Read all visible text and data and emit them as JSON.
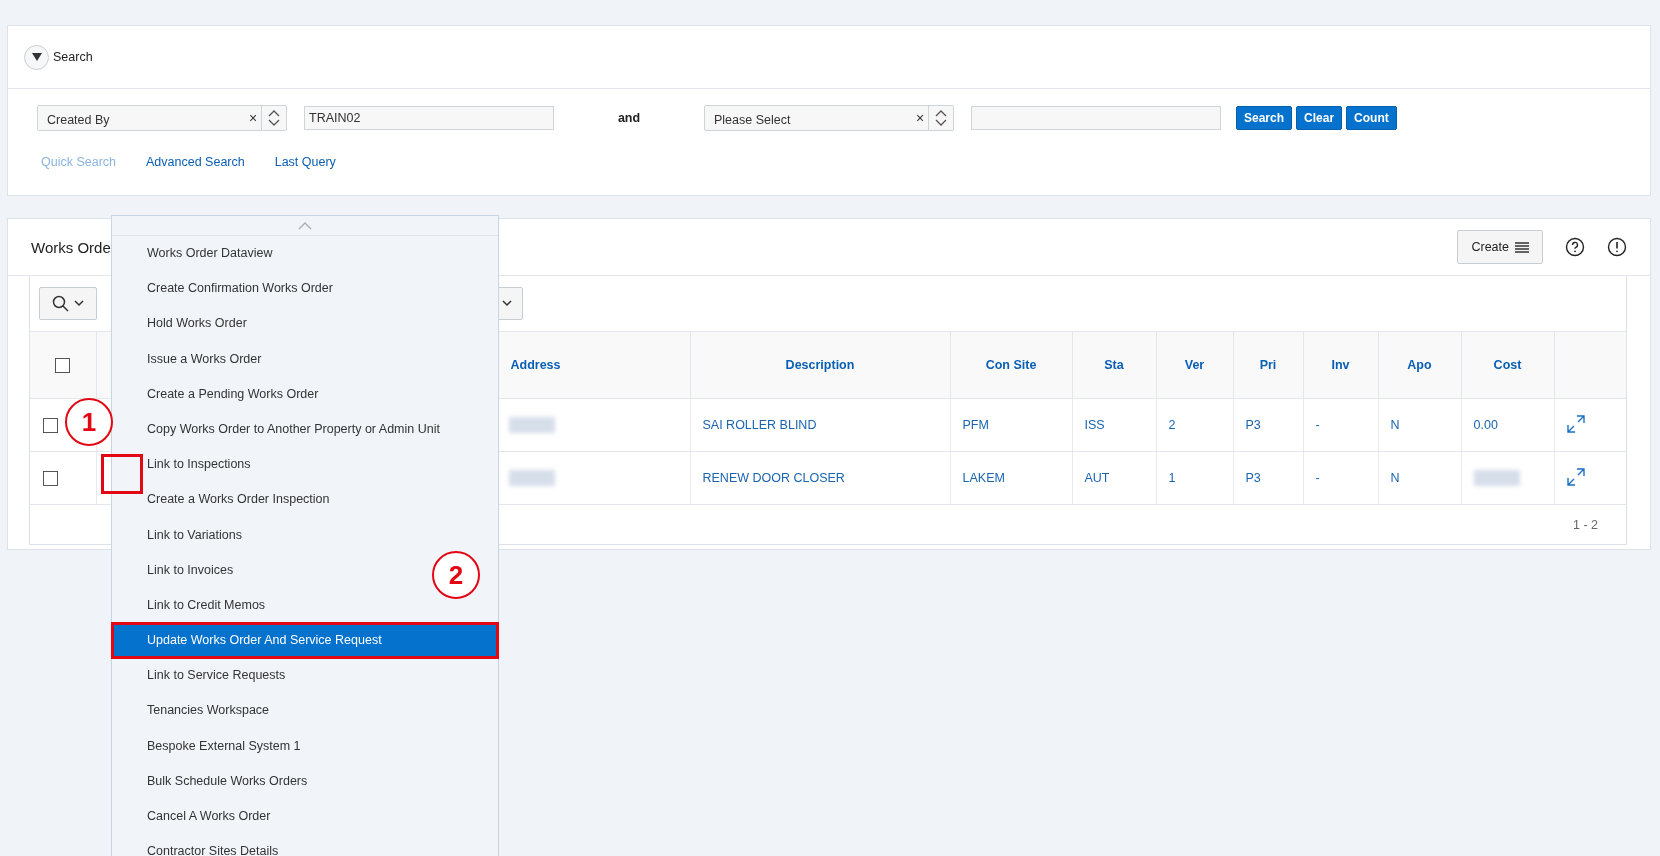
{
  "search": {
    "title": "Search",
    "criteria": [
      {
        "field": "Created By",
        "clear_icon": "×",
        "value": "TRAIN02"
      },
      {
        "field": "Please Select",
        "clear_icon": "×"
      }
    ],
    "conjunction": "and",
    "buttons": [
      "Search",
      "Clear",
      "Count"
    ],
    "links": [
      {
        "label": "Quick Search",
        "selected": true
      },
      {
        "label": "Advanced Search",
        "selected": false
      },
      {
        "label": "Last Query",
        "selected": false
      }
    ]
  },
  "works_orders": {
    "title": "Works Orde",
    "create_button": "Create",
    "table": {
      "all_checked": false,
      "columns": [
        "Address",
        "Description",
        "Con Site",
        "Sta",
        "Ver",
        "Pri",
        "Inv",
        "Apo",
        "Cost"
      ],
      "rows": [
        {
          "checked": false,
          "description": "SAI ROLLER BLIND",
          "con_site": "PFM",
          "sta": "ISS",
          "ver": "2",
          "pri": "P3",
          "inv": "-",
          "apo": "N",
          "cost": "0.00"
        },
        {
          "checked": false,
          "description": "RENEW DOOR CLOSER",
          "con_site": "LAKEM",
          "sta": "AUT",
          "ver": "1",
          "pri": "P3",
          "inv": "-",
          "apo": "N"
        }
      ],
      "pagination": "1 - 2"
    }
  },
  "row_menu": {
    "items": [
      {
        "label": "Works Order Dataview",
        "selected": false
      },
      {
        "label": "Create Confirmation Works Order",
        "selected": false
      },
      {
        "label": "Hold Works Order",
        "selected": false
      },
      {
        "label": "Issue a Works Order",
        "selected": false
      },
      {
        "label": "Create a Pending Works Order",
        "selected": false
      },
      {
        "label": "Copy Works Order to Another Property or Admin Unit",
        "selected": false
      },
      {
        "label": "Link to Inspections",
        "selected": false
      },
      {
        "label": "Create a Works Order Inspection",
        "selected": false
      },
      {
        "label": "Link to Variations",
        "selected": false
      },
      {
        "label": "Link to Invoices",
        "selected": false
      },
      {
        "label": "Link to Credit Memos",
        "selected": false
      },
      {
        "label": "Update Works Order And Service Request",
        "selected": true
      },
      {
        "label": "Link to Service Requests",
        "selected": false
      },
      {
        "label": "Tenancies Workspace",
        "selected": false
      },
      {
        "label": "Bespoke External System 1",
        "selected": false
      },
      {
        "label": "Bulk Schedule Works Orders",
        "selected": false
      },
      {
        "label": "Cancel A Works Order",
        "selected": false
      },
      {
        "label": "Contractor Sites Details",
        "selected": false
      }
    ]
  },
  "annotations": [
    {
      "kind": "circle",
      "label": "1"
    },
    {
      "kind": "box"
    },
    {
      "kind": "circle",
      "label": "2"
    }
  ]
}
